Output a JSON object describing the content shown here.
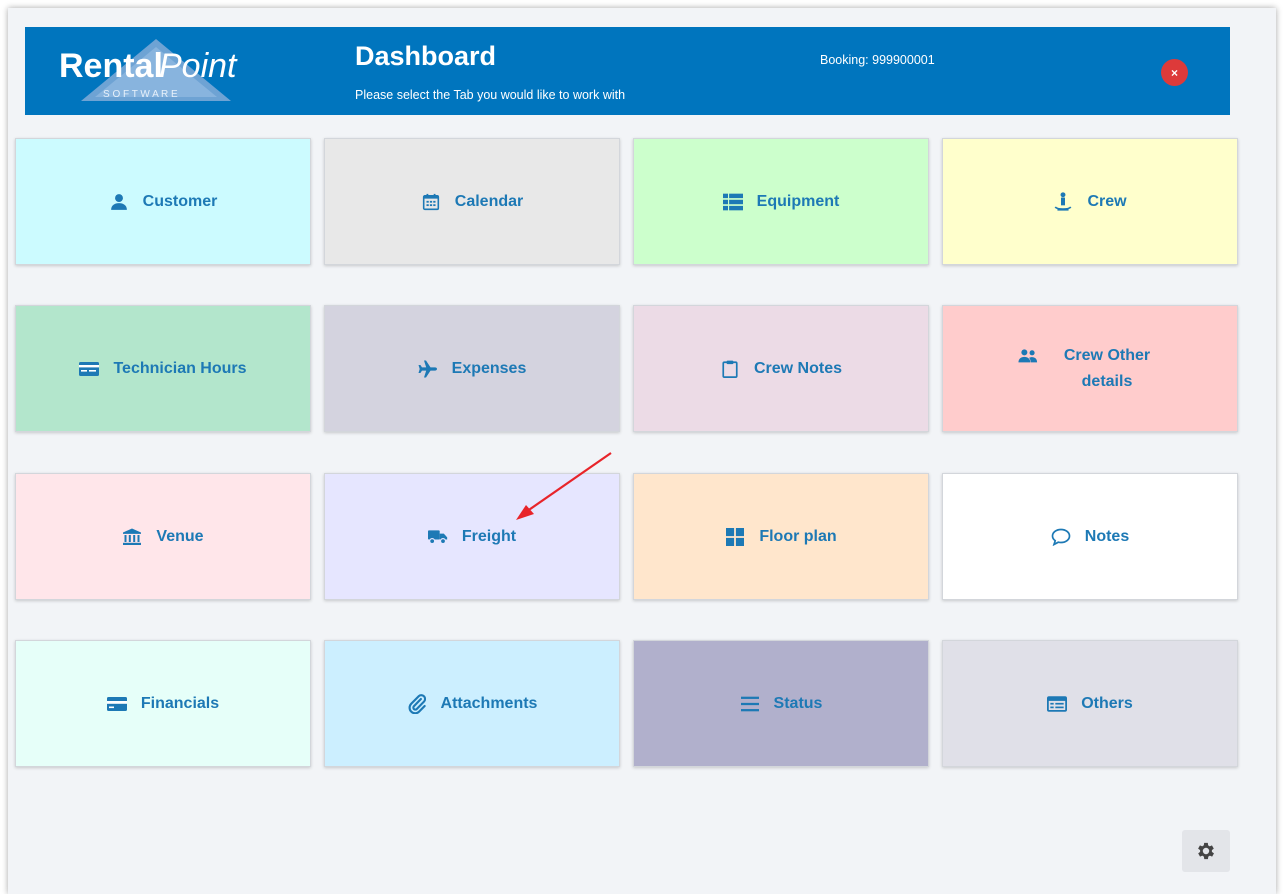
{
  "header": {
    "logo_text_main": "Rental",
    "logo_text_italic": "Point",
    "logo_sub": "S O F T W A R E",
    "title": "Dashboard",
    "subtitle": "Please select the Tab you would like to work with",
    "booking": "Booking: 999900001",
    "close_icon_glyph": "×",
    "bg_color": "#0075be"
  },
  "tiles": [
    {
      "label": "Customer",
      "icon": "user-icon",
      "bg": "#ccfbff"
    },
    {
      "label": "Calendar",
      "icon": "calendar-icon",
      "bg": "#e8e8e8"
    },
    {
      "label": "Equipment",
      "icon": "list-icon",
      "bg": "#ccffcc"
    },
    {
      "label": "Crew",
      "icon": "crew-icon",
      "bg": "#ffffcc"
    },
    {
      "label": "Technician Hours",
      "icon": "card-icon",
      "bg": "#b3e6cc"
    },
    {
      "label": "Expenses",
      "icon": "plane-icon",
      "bg": "#d4d3df"
    },
    {
      "label": "Crew Notes",
      "icon": "clipboard-icon",
      "bg": "#ecdbe6"
    },
    {
      "label": "Crew Other details",
      "icon": "users-icon",
      "bg": "#ffcccc"
    },
    {
      "label": "Venue",
      "icon": "bank-icon",
      "bg": "#ffe6ea"
    },
    {
      "label": "Freight",
      "icon": "truck-icon",
      "bg": "#e6e6ff"
    },
    {
      "label": "Floor plan",
      "icon": "grid-icon",
      "bg": "#ffe6cc"
    },
    {
      "label": "Notes",
      "icon": "comment-icon",
      "bg": "#ffffff"
    },
    {
      "label": "Financials",
      "icon": "credit-card-icon",
      "bg": "#e6fff9"
    },
    {
      "label": "Attachments",
      "icon": "paperclip-icon",
      "bg": "#ccefff"
    },
    {
      "label": "Status",
      "icon": "bars-icon",
      "bg": "#b1b0cc"
    },
    {
      "label": "Others",
      "icon": "table-icon",
      "bg": "#e0e0e8"
    }
  ],
  "settings": {
    "icon": "gear-icon"
  },
  "annotation": {
    "arrow_color": "#e8242a"
  }
}
